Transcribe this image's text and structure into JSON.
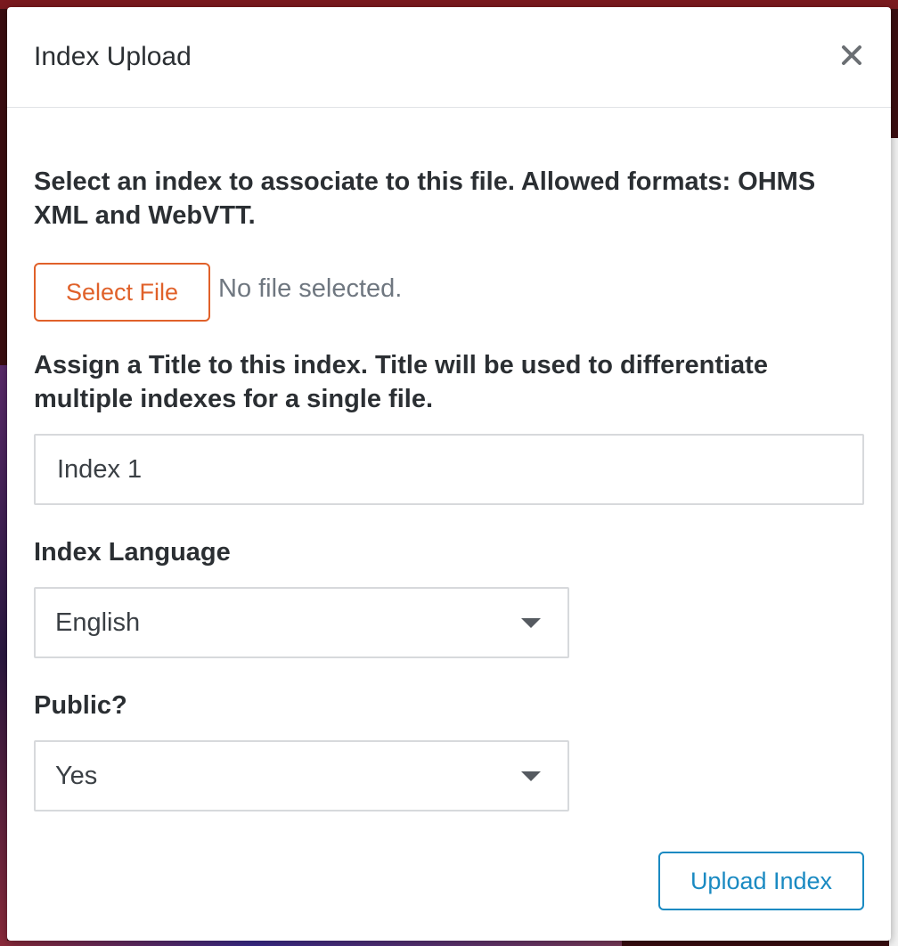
{
  "modal": {
    "title": "Index Upload",
    "close_icon": "close-icon"
  },
  "file_section": {
    "instructions": "Select an index to associate to this file. Allowed formats: OHMS XML and WebVTT.",
    "select_button_label": "Select File",
    "status_text": "No file selected."
  },
  "title_section": {
    "instructions": "Assign a Title to this index. Title will be used to differentiate multiple indexes for a single file.",
    "input_value": "Index 1"
  },
  "language_section": {
    "label": "Index Language",
    "selected": "English",
    "arrow_icon": "dropdown-arrow-icon"
  },
  "public_section": {
    "label": "Public?",
    "selected": "Yes",
    "arrow_icon": "dropdown-arrow-icon"
  },
  "footer": {
    "upload_button_label": "Upload Index"
  },
  "colors": {
    "select_file_accent": "#e0612a",
    "upload_accent": "#1a8ac2"
  }
}
